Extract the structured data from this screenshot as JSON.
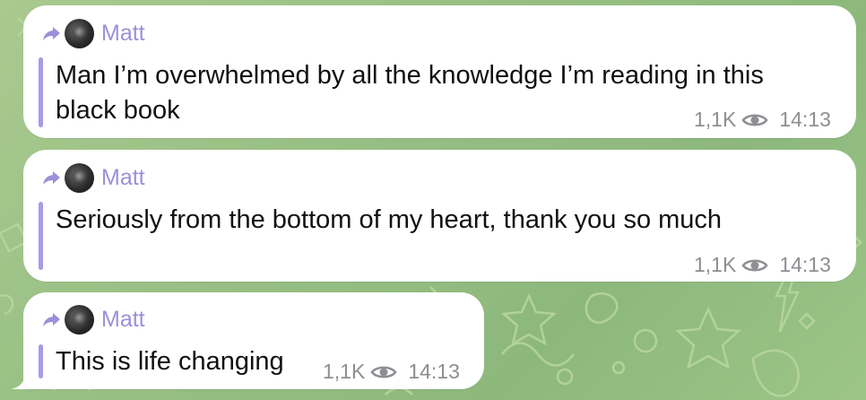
{
  "messages": [
    {
      "sender": "Matt",
      "text_line1": "Man I’m overwhelmed by all the knowledge I’m reading in this",
      "text_line2": "black book",
      "views": "1,1K",
      "time": "14:13"
    },
    {
      "sender": "Matt",
      "text_line1": "Seriously from the bottom of my heart, thank you so much",
      "views": "1,1K",
      "time": "14:13"
    },
    {
      "sender": "Matt",
      "text_line1": "This is life changing",
      "views": "1,1K",
      "time": "14:13"
    }
  ],
  "colors": {
    "sender": "#9d8fd9",
    "quote_bar": "#a99ae6",
    "meta": "#8e8e93",
    "background": "#97bf83"
  },
  "icons": [
    "forward-arrow-icon",
    "eye-icon"
  ]
}
